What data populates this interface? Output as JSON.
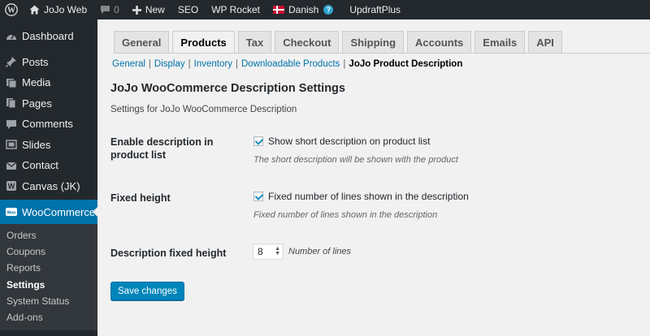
{
  "adminbar": {
    "site_name": "JoJo Web",
    "comments_count": "0",
    "new_label": "New",
    "seo_label": "SEO",
    "wprocket_label": "WP Rocket",
    "language_label": "Danish",
    "help_glyph": "?",
    "updraft_label": "UpdraftPlus"
  },
  "sidebar": {
    "items": [
      {
        "label": "Dashboard",
        "icon": "dashboard-icon"
      },
      {
        "label": "Posts",
        "icon": "pin-icon"
      },
      {
        "label": "Media",
        "icon": "media-icon"
      },
      {
        "label": "Pages",
        "icon": "pages-icon"
      },
      {
        "label": "Comments",
        "icon": "comment-icon"
      },
      {
        "label": "Slides",
        "icon": "slides-icon"
      },
      {
        "label": "Contact",
        "icon": "mail-icon"
      },
      {
        "label": "Canvas (JK)",
        "icon": "canvas-icon"
      }
    ],
    "active_item": {
      "label": "WooCommerce",
      "icon": "woocommerce-icon",
      "icon_text": "Woo"
    },
    "submenu": [
      "Orders",
      "Coupons",
      "Reports",
      "Settings",
      "System Status",
      "Add-ons"
    ],
    "submenu_current": "Settings"
  },
  "tabs": [
    "General",
    "Products",
    "Tax",
    "Checkout",
    "Shipping",
    "Accounts",
    "Emails",
    "API"
  ],
  "active_tab": "Products",
  "subsections": {
    "links": [
      "General",
      "Display",
      "Inventory",
      "Downloadable Products"
    ],
    "current": "JoJo Product Description",
    "separator": "|"
  },
  "settings": {
    "title": "JoJo WooCommerce Description Settings",
    "description": "Settings for JoJo WooCommerce Description",
    "fields": {
      "enable": {
        "label": "Enable description in product list",
        "checkbox_label": "Show short description on product list",
        "checked": true,
        "help": "The short description will be shown with the product"
      },
      "fixed_height": {
        "label": "Fixed height",
        "checkbox_label": "Fixed number of lines shown in the description",
        "checked": true,
        "help": "Fixed number of lines shown in the description"
      },
      "height_value": {
        "label": "Description fixed height",
        "value": "8",
        "suffix": "Number of lines"
      }
    },
    "save_label": "Save changes"
  },
  "colors": {
    "adminbar_bg": "#23282d",
    "accent": "#0073aa",
    "button": "#0085ba",
    "page_bg": "#f1f1f1"
  }
}
